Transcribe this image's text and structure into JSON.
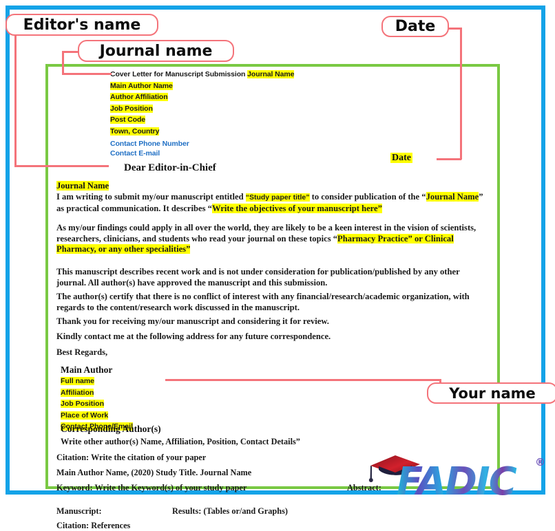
{
  "frame": {
    "outer_border_color": "#14a3e8",
    "letter_border_color": "#7ac943",
    "callout_color": "#f4737a",
    "highlight_color": "#ffff00",
    "link_color": "#1f6fc4"
  },
  "callouts": [
    {
      "id": "editors-name",
      "label": "Editor's name"
    },
    {
      "id": "journal-name",
      "label": "Journal name"
    },
    {
      "id": "date-top",
      "label": "Date"
    },
    {
      "id": "your-name",
      "label": "Your name"
    }
  ],
  "letter": {
    "header": {
      "cover_title": "Cover Letter for Manuscript Submission ",
      "journal_name": "Journal Name",
      "lines": [
        {
          "text": "Main Author Name",
          "style": "highlight"
        },
        {
          "text": "Author Affiliation",
          "style": "highlight"
        },
        {
          "text": "Job Position",
          "style": "highlight"
        },
        {
          "text": "Post Code",
          "style": "highlight"
        },
        {
          "text": "Town, Country",
          "style": "highlight"
        },
        {
          "text": "Contact Phone Number",
          "style": "link"
        },
        {
          "text": "Contact E-mail",
          "style": "link"
        }
      ]
    },
    "date_field": "Date",
    "salutation": "Dear Editor-in-Chief",
    "journal_name_line": "Journal Name",
    "para1": {
      "t1": "I am writing to submit my/our manuscript entitled ",
      "hl1": "“Study paper title”",
      "t2": " to consider publication of the “",
      "hl2": "Journal Name",
      "t3": "” as practical communication. It describes “",
      "hl3": "Write the objectives of your manuscript here”"
    },
    "para2": {
      "t1": " As my/our findings could apply in all over the world, they are likely to be a keen interest in the vision of scientists, researchers, clinicians, and students who read your journal on these topics “",
      "hl1": "Pharmacy Practice” or Clinical Pharmacy, or any other specialities”"
    },
    "para3": "This manuscript describes recent work and is not under consideration for publication/published by any other journal. All author(s) have approved the manuscript and this submission.",
    "para4": "The author(s) certify that there is no conflict of interest with any financial/research/academic organization, with regards to the content/research work discussed in the manuscript.",
    "para5": "Thank you for receiving my/our manuscript and considering it for review.",
    "para6": "Kindly contact me at the following address for any future correspondence.",
    "para7": "Best Regards,",
    "signature": {
      "heading": "Main Author",
      "items": [
        "Full name",
        "Affiliation",
        "Job Position",
        "Place of Work",
        "Contact Phone/Email"
      ]
    },
    "corresponding": {
      "heading": "Corresponding Author(s)",
      "note": " Write other author(s) Name, Affiliation, Position, Contact Details”"
    },
    "footer": {
      "citation_label": "Citation: Write the citation of your paper",
      "citation_example": "Main Author Name, (2020) Study Title. Journal Name",
      "keyword": "Keyword: Write the Keyword(s) of your study paper",
      "abstract": "Abstract:",
      "manuscript": "Manuscript:",
      "results": "Results: (Tables or/and Graphs)",
      "references": "Citation: References"
    }
  },
  "logo": {
    "wordmark": "FADIC",
    "trademark": "®",
    "icon": "graduation-cap-icon"
  }
}
